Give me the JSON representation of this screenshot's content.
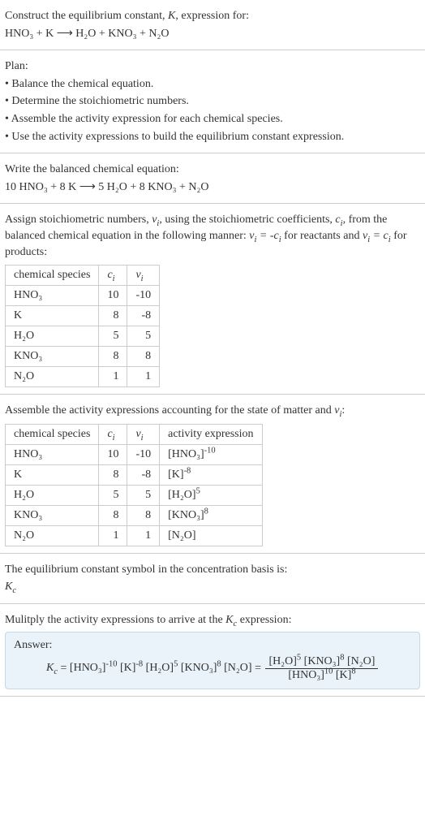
{
  "s1": {
    "l1_a": "Construct the equilibrium constant, ",
    "l1_b": ", expression for:",
    "eq": "HNO₃ + K ⟶ H₂O + KNO₃ + N₂O"
  },
  "s2": {
    "title": "Plan:",
    "b1": "• Balance the chemical equation.",
    "b2": "• Determine the stoichiometric numbers.",
    "b3": "• Assemble the activity expression for each chemical species.",
    "b4": "• Use the activity expressions to build the equilibrium constant expression."
  },
  "s3": {
    "l1": "Write the balanced chemical equation:",
    "eq": "10 HNO₃ + 8 K ⟶ 5 H₂O + 8 KNO₃ + N₂O"
  },
  "s4": {
    "text_a": "Assign stoichiometric numbers, ",
    "text_b": ", using the stoichiometric coefficients, ",
    "text_c": ", from the balanced chemical equation in the following manner: ",
    "text_d": " for reactants and ",
    "text_e": " for products:",
    "h1": "chemical species",
    "rows": [
      {
        "sp": "HNO₃",
        "c": "10",
        "v": "-10"
      },
      {
        "sp": "K",
        "c": "8",
        "v": "-8"
      },
      {
        "sp": "H₂O",
        "c": "5",
        "v": "5"
      },
      {
        "sp": "KNO₃",
        "c": "8",
        "v": "8"
      },
      {
        "sp": "N₂O",
        "c": "1",
        "v": "1"
      }
    ]
  },
  "s5": {
    "text_a": "Assemble the activity expressions accounting for the state of matter and ",
    "text_b": ":",
    "h1": "chemical species",
    "h4": "activity expression",
    "rows": [
      {
        "sp": "HNO₃",
        "c": "10",
        "v": "-10",
        "act_base": "[HNO₃]",
        "act_exp": "-10"
      },
      {
        "sp": "K",
        "c": "8",
        "v": "-8",
        "act_base": "[K]",
        "act_exp": "-8"
      },
      {
        "sp": "H₂O",
        "c": "5",
        "v": "5",
        "act_base": "[H₂O]",
        "act_exp": "5"
      },
      {
        "sp": "KNO₃",
        "c": "8",
        "v": "8",
        "act_base": "[KNO₃]",
        "act_exp": "8"
      },
      {
        "sp": "N₂O",
        "c": "1",
        "v": "1",
        "act_base": "[N₂O]",
        "act_exp": ""
      }
    ]
  },
  "s6": {
    "l1": "The equilibrium constant symbol in the concentration basis is:"
  },
  "s7": {
    "l1_a": "Mulitply the activity expressions to arrive at the ",
    "l1_b": " expression:",
    "answer": "Answer:"
  },
  "chart_data": {
    "type": "table",
    "title": "Stoichiometric numbers and activity expressions",
    "tables": [
      {
        "columns": [
          "chemical species",
          "c_i",
          "ν_i"
        ],
        "rows": [
          [
            "HNO₃",
            10,
            -10
          ],
          [
            "K",
            8,
            -8
          ],
          [
            "H₂O",
            5,
            5
          ],
          [
            "KNO₃",
            8,
            8
          ],
          [
            "N₂O",
            1,
            1
          ]
        ]
      },
      {
        "columns": [
          "chemical species",
          "c_i",
          "ν_i",
          "activity expression"
        ],
        "rows": [
          [
            "HNO₃",
            10,
            -10,
            "[HNO₃]^-10"
          ],
          [
            "K",
            8,
            -8,
            "[K]^-8"
          ],
          [
            "H₂O",
            5,
            5,
            "[H₂O]^5"
          ],
          [
            "KNO₃",
            8,
            8,
            "[KNO₃]^8"
          ],
          [
            "N₂O",
            1,
            1,
            "[N₂O]"
          ]
        ]
      }
    ],
    "balanced_equation": "10 HNO₃ + 8 K ⟶ 5 H₂O + 8 KNO₃ + N₂O",
    "equilibrium_constant": "K_c = [HNO₃]^-10 [K]^-8 [H₂O]^5 [KNO₃]^8 [N₂O] = ([H₂O]^5 [KNO₃]^8 [N₂O]) / ([HNO₃]^10 [K]^8)"
  }
}
